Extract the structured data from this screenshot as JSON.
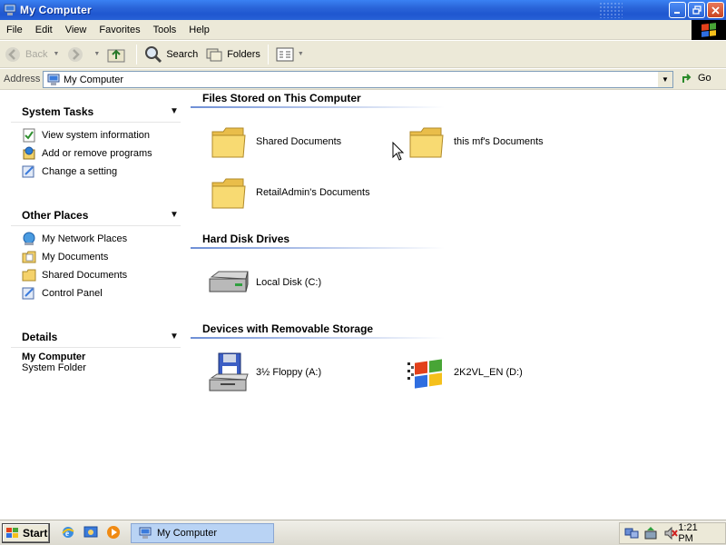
{
  "window": {
    "title": "My Computer"
  },
  "menu": [
    "File",
    "Edit",
    "View",
    "Favorites",
    "Tools",
    "Help"
  ],
  "toolbar": {
    "back": "Back",
    "search": "Search",
    "folders": "Folders"
  },
  "address": {
    "label": "Address",
    "value": "My Computer",
    "go": "Go"
  },
  "left": {
    "system_tasks": {
      "title": "System Tasks",
      "items": [
        "View system information",
        "Add or remove programs",
        "Change a setting"
      ]
    },
    "other_places": {
      "title": "Other Places",
      "items": [
        "My Network Places",
        "My Documents",
        "Shared Documents",
        "Control Panel"
      ]
    },
    "details": {
      "title": "Details",
      "name": "My Computer",
      "type": "System Folder"
    }
  },
  "sections": {
    "files": {
      "title": "Files Stored on This Computer",
      "items": [
        "Shared Documents",
        "this mf's Documents",
        "RetailAdmin's Documents"
      ]
    },
    "drives": {
      "title": "Hard Disk Drives",
      "items": [
        "Local Disk (C:)"
      ]
    },
    "removable": {
      "title": "Devices with Removable Storage",
      "items": [
        "3½ Floppy (A:)",
        "2K2VL_EN (D:)"
      ]
    }
  },
  "taskbar": {
    "start": "Start",
    "task": "My Computer",
    "clock": "1:21 PM"
  },
  "colors": {
    "titlebar": "#2a64d8",
    "chrome": "#ece9d8",
    "folder": "#f5d26a",
    "task_active": "#b9d3f4"
  }
}
